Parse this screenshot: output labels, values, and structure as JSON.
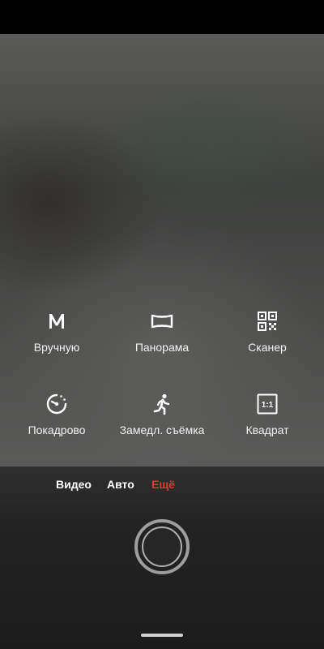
{
  "modes": [
    {
      "id": "manual",
      "label": "Вручную",
      "icon": "m-letter-icon"
    },
    {
      "id": "panorama",
      "label": "Панорама",
      "icon": "panorama-icon"
    },
    {
      "id": "scanner",
      "label": "Сканер",
      "icon": "qr-code-icon"
    },
    {
      "id": "timelapse",
      "label": "Покадрово",
      "icon": "timelapse-icon"
    },
    {
      "id": "slowmo",
      "label": "Замедл. съёмка",
      "icon": "running-person-icon"
    },
    {
      "id": "square",
      "label": "Квадрат",
      "icon": "square-ratio-icon",
      "icon_text": "1:1"
    }
  ],
  "tabs": {
    "video": "Видео",
    "auto": "Авто",
    "more": "Ещё",
    "active": "more",
    "active_color": "#e53935"
  }
}
